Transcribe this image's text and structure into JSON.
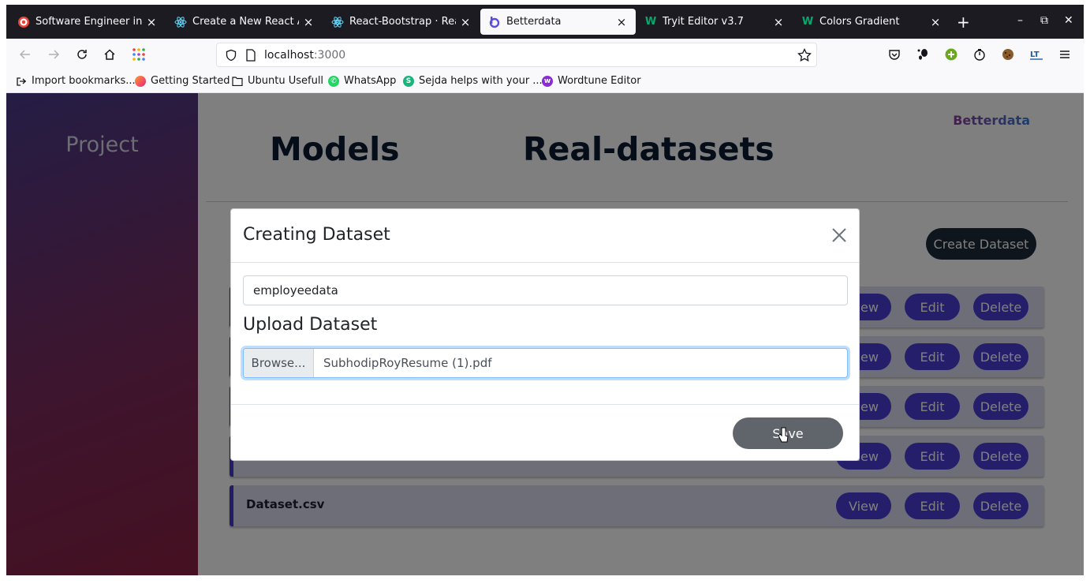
{
  "browser": {
    "tabs": [
      {
        "label": "Software Engineer intern",
        "icon": "target-icon",
        "active": false
      },
      {
        "label": "Create a New React App",
        "icon": "react-icon",
        "active": false
      },
      {
        "label": "React-Bootstrap · React",
        "icon": "react-bootstrap-icon",
        "active": false
      },
      {
        "label": "Betterdata",
        "icon": "betterdata-icon",
        "active": true
      },
      {
        "label": "Tryit Editor v3.7",
        "icon": "w3schools-icon",
        "active": false
      },
      {
        "label": "Colors Gradient",
        "icon": "w3schools-icon",
        "active": false
      }
    ],
    "url_host": "localhost",
    "url_port": ":3000",
    "bookmarks": [
      {
        "label": "Import bookmarks...",
        "icon": "import-icon"
      },
      {
        "label": "Getting Started",
        "icon": "firefox-icon"
      },
      {
        "label": "Ubuntu Usefull",
        "icon": "folder-icon"
      },
      {
        "label": "WhatsApp",
        "icon": "whatsapp-icon"
      },
      {
        "label": "Sejda helps with your ...",
        "icon": "sejda-icon"
      },
      {
        "label": "Wordtune Editor",
        "icon": "wordtune-icon"
      }
    ]
  },
  "app": {
    "sidebar_title": "Project",
    "brand": "Betterdata",
    "nav": {
      "models": "Models",
      "datasets": "Real-datasets"
    },
    "create_button": "Create Dataset",
    "rows": [
      {
        "name": ""
      },
      {
        "name": ""
      },
      {
        "name": ""
      },
      {
        "name": ""
      },
      {
        "name": "Dataset.csv"
      }
    ],
    "row_actions": {
      "view": "View",
      "edit": "Edit",
      "delete": "Delete"
    }
  },
  "modal": {
    "title": "Creating Dataset",
    "name_value": "employeedata",
    "upload_label": "Upload Dataset",
    "browse_label": "Browse...",
    "file_name": "SubhodipRoyResume (1).pdf",
    "save_label": "Save"
  },
  "colors": {
    "primary_pill": "#4a3fd6",
    "dark_button": "#1c2a3a",
    "save_button": "#5f656b",
    "heading": "#0b1a33"
  }
}
